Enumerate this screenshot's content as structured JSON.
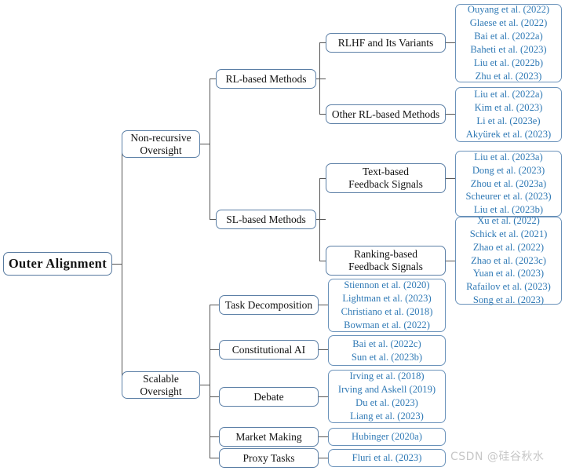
{
  "diagram": {
    "title": "Outer Alignment taxonomy tree",
    "root": {
      "label": "Outer Alignment"
    },
    "accent_border": "#5b7fa6",
    "citation_color": "#2f79b5",
    "edge_color": "#555555"
  },
  "nodes": {
    "non_recursive_oversight": {
      "line1": "Non-recursive",
      "line2": "Oversight"
    },
    "scalable_oversight": {
      "line1": "Scalable",
      "line2": "Oversight"
    },
    "rl_based_methods": {
      "label": "RL-based Methods"
    },
    "sl_based_methods": {
      "label": "SL-based Methods"
    },
    "rlhf_and_its_variants": {
      "label": "RLHF and Its Variants"
    },
    "other_rl_based_methods": {
      "label": "Other RL-based Methods"
    },
    "text_based_feedback_signals": {
      "line1": "Text-based",
      "line2": "Feedback Signals"
    },
    "ranking_based_feedback_signals": {
      "line1": "Ranking-based",
      "line2": "Feedback Signals"
    },
    "task_decomposition": {
      "label": "Task Decomposition"
    },
    "constitutional_ai": {
      "label": "Constitutional AI"
    },
    "debate": {
      "label": "Debate"
    },
    "market_making": {
      "label": "Market Making"
    },
    "proxy_tasks": {
      "label": "Proxy Tasks"
    }
  },
  "citations": {
    "rlhf_and_its_variants": [
      "Ouyang et al. (2022)",
      "Glaese et al. (2022)",
      "Bai et al. (2022a)",
      "Baheti et al. (2023)",
      "Liu et al. (2022b)",
      "Zhu et al. (2023)"
    ],
    "other_rl_based_methods": [
      "Liu et al. (2022a)",
      "Kim et al. (2023)",
      "Li et al. (2023e)",
      "Akyürek et al. (2023)"
    ],
    "text_based_feedback_signals": [
      "Liu et al. (2023a)",
      "Dong et al. (2023)",
      "Zhou et al. (2023a)",
      "Scheurer et al. (2023)",
      "Liu et al. (2023b)"
    ],
    "ranking_based_feedback_signals": [
      "Xu et al. (2022)",
      "Schick et al. (2021)",
      "Zhao et al. (2022)",
      "Zhao et al. (2023c)",
      "Yuan et al. (2023)",
      "Rafailov et al. (2023)",
      "Song et al. (2023)"
    ],
    "task_decomposition": [
      "Stiennon et al. (2020)",
      "Lightman et al. (2023)",
      "Christiano et al. (2018)",
      "Bowman et al. (2022)"
    ],
    "constitutional_ai": [
      "Bai et al. (2022c)",
      "Sun et al. (2023b)"
    ],
    "debate": [
      "Irving et al. (2018)",
      "Irving and Askell (2019)",
      "Du et al. (2023)",
      "Liang et al. (2023)"
    ],
    "market_making": [
      "Hubinger (2020a)"
    ],
    "proxy_tasks": [
      "Fluri et al. (2023)"
    ]
  },
  "watermark": {
    "text": "CSDN @硅谷秋水"
  }
}
